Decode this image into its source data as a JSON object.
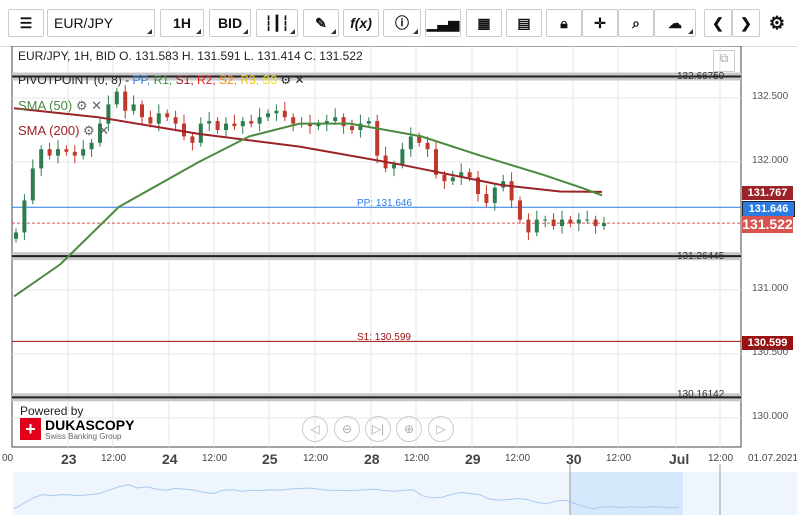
{
  "toolbar": {
    "instrument": "EUR/JPY",
    "timeframe": "1H",
    "side": "BID",
    "icons": [
      "menu-icon",
      "candle-type-icon",
      "draw-icon",
      "function-icon",
      "info-icon",
      "bar-chart-icon",
      "calendar-icon",
      "calculator-icon",
      "lock-icon",
      "crosshair-icon",
      "zoom-icon",
      "upload-icon",
      "chevron-left-icon",
      "chevron-right-icon",
      "gear-icon"
    ]
  },
  "legend": {
    "summary": "EUR/JPY, 1H, BID   O. 131.583 H. 131.591 L. 131.414 C. 131.522",
    "pivot": "PIVOTPOINT (0, 8)",
    "pivot_items": [
      {
        "t": "PP,",
        "c": "#3a7ee0"
      },
      {
        "t": "R1,",
        "c": "#3a8a3a"
      },
      {
        "t": "S1,",
        "c": "#a01818"
      },
      {
        "t": "R2,",
        "c": "#e02020"
      },
      {
        "t": "S2,",
        "c": "#f08a10"
      },
      {
        "t": "R3,",
        "c": "#f0c000"
      },
      {
        "t": "S3",
        "c": "#f0e000"
      }
    ],
    "sma50": "SMA (50)",
    "sma200": "SMA (200)"
  },
  "levels": {
    "top": "132.66759",
    "mid": "131.26445",
    "bottom": "130.16142",
    "pp": "PP: 131.646",
    "s1": "S1: 130.599"
  },
  "price_tags": {
    "sma200": "131.767",
    "pp": "131.646",
    "last": "131.522",
    "s1": "130.599"
  },
  "colors": {
    "up": "#2e7d4f",
    "down": "#c0392b",
    "sma50": "#4a8a3e",
    "sma200": "#9b2226",
    "pp": "#2a7be4",
    "s1": "#9b1010",
    "last": "#d9534f"
  },
  "branding": {
    "powered": "Powered by",
    "name": "DUKASCOPY",
    "sub": "Swiss Banking Group"
  },
  "nav_icons": [
    "scroll-left-icon",
    "zoom-out-icon",
    "scroll-end-icon",
    "zoom-in-icon",
    "scroll-right-icon"
  ],
  "chart_data": {
    "type": "candlestick",
    "symbol": "EUR/JPY",
    "y_ticks": [
      "132.500",
      "132.000",
      "131.000",
      "130.500",
      "130.000"
    ],
    "x_labels": [
      "00",
      "23",
      "12:00",
      "24",
      "12:00",
      "25",
      "12:00",
      "28",
      "12:00",
      "29",
      "12:00",
      "30",
      "12:00",
      "Jul",
      "12:00",
      "01.07.2021"
    ],
    "bar_hours": 2,
    "closes": [
      131.45,
      131.7,
      131.95,
      132.1,
      132.05,
      132.1,
      132.08,
      132.05,
      132.1,
      132.15,
      132.3,
      132.45,
      132.55,
      132.4,
      132.45,
      132.35,
      132.3,
      132.38,
      132.35,
      132.3,
      132.2,
      132.15,
      132.3,
      132.32,
      132.25,
      132.3,
      132.28,
      132.32,
      132.3,
      132.35,
      132.38,
      132.4,
      132.35,
      132.3,
      132.3,
      132.28,
      132.3,
      132.32,
      132.35,
      132.28,
      132.25,
      132.3,
      132.32,
      132.05,
      131.95,
      131.98,
      132.1,
      132.2,
      132.15,
      132.1,
      131.9,
      131.85,
      131.88,
      131.92,
      131.88,
      131.75,
      131.68,
      131.8,
      131.85,
      131.7,
      131.55,
      131.45,
      131.55,
      131.55,
      131.5,
      131.55,
      131.52,
      131.55,
      131.55,
      131.5,
      131.522
    ],
    "sma50": [
      [
        0,
        130.95
      ],
      [
        11,
        131.2
      ],
      [
        25,
        131.65
      ],
      [
        44,
        132.0
      ],
      [
        56,
        132.2
      ],
      [
        68,
        132.3
      ],
      [
        80,
        132.3
      ],
      [
        97,
        132.2
      ],
      [
        111,
        132.05
      ],
      [
        126,
        131.9
      ],
      [
        135,
        131.8
      ],
      [
        140,
        131.74
      ]
    ],
    "sma200": [
      [
        0,
        132.42
      ],
      [
        20,
        132.35
      ],
      [
        44,
        132.22
      ],
      [
        68,
        132.12
      ],
      [
        92,
        131.98
      ],
      [
        116,
        131.82
      ],
      [
        130,
        131.77
      ],
      [
        140,
        131.767
      ]
    ]
  }
}
